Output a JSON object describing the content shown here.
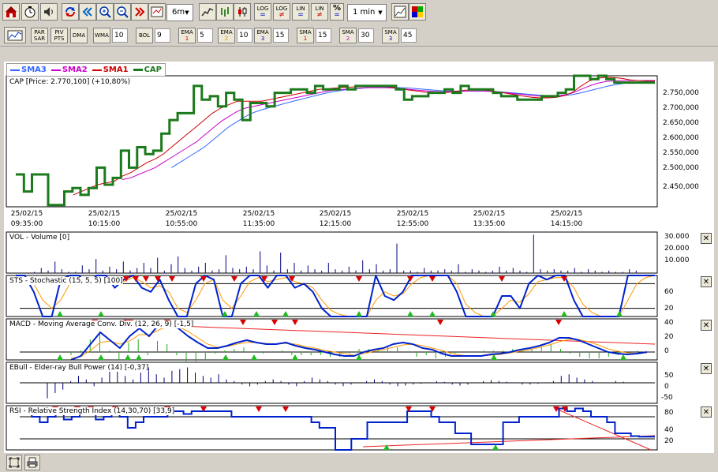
{
  "toolbar": {
    "period_value": "6m",
    "interval_value": "1 min",
    "log_label": "LOG",
    "lin_label": "LIN",
    "percent_label": "%",
    "par_sar": [
      "PAR",
      "SAR"
    ],
    "piv_pts": [
      "PIV",
      "PTS"
    ],
    "dma_label": "DMA",
    "wma_label": "WMA",
    "wma_value": "10",
    "bol_label": "BOL",
    "bol_value": "9",
    "ema1_label": "EMA",
    "ema1_num": "1",
    "ema1_value": "5",
    "ema2_label": "EMA",
    "ema2_num": "2",
    "ema2_value": "10",
    "ema3_label": "EMA",
    "ema3_num": "3",
    "ema3_value": "15",
    "sma1_label": "SMA",
    "sma1_num": "1",
    "sma1_value": "15",
    "sma2_label": "SMA",
    "sma2_num": "2",
    "sma2_value": "30",
    "sma3_label": "SMA",
    "sma3_num": "3",
    "sma3_value": "45"
  },
  "legend": {
    "sma3": "SMA3",
    "sma2": "SMA2",
    "sma1": "SMA1",
    "cap": "CAP"
  },
  "colors": {
    "cap": "#1b7a1b",
    "sma1": "#cc0000",
    "sma2": "#cc00cc",
    "sma3": "#3366ff",
    "indicator": "#0022cc",
    "signal": "#ff9900",
    "hist": "#22aa22",
    "trend": "#ee2222"
  },
  "chart_data": [
    {
      "type": "line",
      "title": "CAP [Price: 2.770,100] (+10,80%)",
      "x": [
        "25/02/15 09:35:00",
        "25/02/15 10:15:00",
        "25/02/15 10:55:00",
        "25/02/15 11:35:00",
        "25/02/15 12:15:00",
        "25/02/15 12:55:00",
        "25/02/15 13:35:00",
        "25/02/15 14:15:00"
      ],
      "x_tick_dates": [
        "25/02/15",
        "25/02/15",
        "25/02/15",
        "25/02/15",
        "25/02/15",
        "25/02/15",
        "25/02/15",
        "25/02/15"
      ],
      "x_tick_times": [
        "09:35:00",
        "10:15:00",
        "10:55:00",
        "11:35:00",
        "12:15:00",
        "12:55:00",
        "13:35:00",
        "14:15:00"
      ],
      "y_ticks": [
        "2.750,000",
        "2.700,000",
        "2.650,000",
        "2.600,000",
        "2.550,000",
        "2.500,000",
        "2.450,000"
      ],
      "ylim": [
        2405,
        2790
      ],
      "series": [
        {
          "name": "CAP",
          "values": [
            2500,
            2450,
            2500,
            2500,
            2410,
            2410,
            2450,
            2460,
            2440,
            2460,
            2520,
            2470,
            2490,
            2570,
            2520,
            2580,
            2560,
            2570,
            2620,
            2660,
            2680,
            2680,
            2760,
            2720,
            2730,
            2700,
            2740,
            2720,
            2660,
            2710,
            2710,
            2700,
            2740,
            2740,
            2750,
            2750,
            2740,
            2760,
            2750,
            2750,
            2760,
            2750,
            2760,
            2760,
            2760,
            2760,
            2760,
            2750,
            2720,
            2730,
            2730,
            2740,
            2740,
            2750,
            2740,
            2760,
            2750,
            2750,
            2750,
            2740,
            2730,
            2730,
            2720,
            2720,
            2720,
            2730,
            2730,
            2740,
            2750,
            2790,
            2790,
            2780,
            2790,
            2780,
            2770,
            2770,
            2770,
            2770,
            2770
          ]
        },
        {
          "name": "SMA1",
          "values": [
            null,
            null,
            null,
            null,
            null,
            null,
            null,
            2440,
            2450,
            2460,
            2470,
            2475,
            2480,
            2495,
            2505,
            2520,
            2535,
            2545,
            2560,
            2580,
            2600,
            2620,
            2640,
            2660,
            2680,
            2695,
            2705,
            2715,
            2715,
            2715,
            2715,
            2720,
            2725,
            2730,
            2735,
            2740,
            2745,
            2750,
            2752,
            2754,
            2756,
            2757,
            2758,
            2758,
            2758,
            2758,
            2756,
            2752,
            2748,
            2745,
            2742,
            2740,
            2740,
            2742,
            2745,
            2748,
            2748,
            2748,
            2746,
            2742,
            2738,
            2734,
            2730,
            2727,
            2725,
            2725,
            2727,
            2732,
            2742,
            2760,
            2775,
            2782,
            2786,
            2785,
            2782,
            2778,
            2776,
            2775,
            2774
          ]
        },
        {
          "name": "SMA2",
          "values": [
            null,
            null,
            null,
            null,
            null,
            null,
            null,
            null,
            null,
            null,
            null,
            null,
            null,
            2485,
            2490,
            2500,
            2510,
            2520,
            2535,
            2550,
            2565,
            2580,
            2595,
            2615,
            2635,
            2655,
            2670,
            2685,
            2695,
            2700,
            2705,
            2710,
            2715,
            2720,
            2725,
            2730,
            2735,
            2740,
            2745,
            2748,
            2750,
            2752,
            2754,
            2755,
            2755,
            2755,
            2754,
            2752,
            2750,
            2748,
            2746,
            2744,
            2743,
            2743,
            2744,
            2745,
            2745,
            2745,
            2744,
            2742,
            2740,
            2737,
            2735,
            2732,
            2730,
            2730,
            2731,
            2734,
            2740,
            2750,
            2760,
            2768,
            2773,
            2775,
            2776,
            2776,
            2776,
            2776,
            2776
          ]
        },
        {
          "name": "SMA3",
          "values": [
            null,
            null,
            null,
            null,
            null,
            null,
            null,
            null,
            null,
            null,
            null,
            null,
            null,
            null,
            null,
            null,
            null,
            null,
            null,
            2520,
            2535,
            2550,
            2565,
            2580,
            2600,
            2620,
            2640,
            2655,
            2670,
            2682,
            2690,
            2697,
            2703,
            2710,
            2716,
            2722,
            2728,
            2734,
            2740,
            2744,
            2748,
            2751,
            2753,
            2755,
            2756,
            2756,
            2756,
            2755,
            2754,
            2752,
            2750,
            2748,
            2746,
            2745,
            2745,
            2745,
            2745,
            2745,
            2744,
            2743,
            2741,
            2739,
            2737,
            2735,
            2733,
            2731,
            2731,
            2732,
            2735,
            2740,
            2746,
            2752,
            2758,
            2763,
            2767,
            2770,
            2772,
            2773,
            2773
          ]
        }
      ]
    },
    {
      "type": "bar",
      "title": "VOL - Volume [0]",
      "y_ticks": [
        "30.000",
        "20.000",
        "10.000"
      ],
      "ylim": [
        0,
        32000
      ],
      "values": [
        0,
        1000,
        4000,
        2000,
        9000,
        3000,
        1000,
        1000,
        6000,
        3000,
        11000,
        2000,
        5000,
        3000,
        9000,
        2000,
        4000,
        8000,
        4000,
        12000,
        2000,
        7000,
        13000,
        4000,
        2000,
        5000,
        8000,
        2000,
        3000,
        14000,
        4000,
        3000,
        5000,
        3000,
        17000,
        6000,
        2000,
        16000,
        3000,
        8000,
        2000,
        6000,
        3000,
        2000,
        8000,
        3000,
        2000,
        5000,
        2000,
        10000,
        3000,
        7000,
        2000,
        3000,
        23000,
        2000,
        2000,
        1000,
        4000,
        2000,
        2000,
        3000,
        2000,
        7000,
        1000,
        3000,
        2000,
        1000,
        2000,
        5000,
        2000,
        4000,
        2000,
        1000,
        30000,
        3000,
        2000,
        3000,
        2000,
        2000,
        4000,
        1000,
        3000,
        2000,
        1000,
        2000,
        1000,
        1000,
        3000,
        2000
      ]
    },
    {
      "type": "line",
      "title": "STS - Stochastic (15, 5, 5) [100]",
      "y_ticks": [
        "60",
        "20"
      ],
      "ylim": [
        0,
        100
      ],
      "series": [
        {
          "name": "%K",
          "values": [
            100,
            100,
            60,
            0,
            0,
            90,
            100,
            100,
            80,
            100,
            100,
            70,
            90,
            100,
            70,
            60,
            90,
            40,
            0,
            0,
            80,
            100,
            90,
            0,
            0,
            80,
            100,
            100,
            70,
            100,
            100,
            70,
            80,
            60,
            20,
            0,
            0,
            0,
            0,
            0,
            100,
            50,
            40,
            60,
            100,
            100,
            100,
            100,
            100,
            60,
            0,
            0,
            0,
            0,
            50,
            50,
            20,
            80,
            100,
            90,
            100,
            100,
            40,
            0,
            0,
            0,
            0,
            0,
            100,
            100,
            100,
            100
          ]
        },
        {
          "name": "%D",
          "values": [
            90,
            95,
            80,
            40,
            20,
            40,
            80,
            95,
            85,
            90,
            95,
            85,
            85,
            95,
            85,
            70,
            75,
            60,
            20,
            10,
            40,
            80,
            90,
            40,
            20,
            50,
            85,
            95,
            85,
            90,
            95,
            85,
            80,
            70,
            40,
            15,
            5,
            0,
            0,
            0,
            40,
            60,
            50,
            55,
            80,
            95,
            100,
            100,
            100,
            80,
            30,
            10,
            0,
            0,
            20,
            40,
            35,
            55,
            85,
            90,
            95,
            95,
            70,
            30,
            10,
            0,
            0,
            0,
            40,
            80,
            95,
            100
          ]
        }
      ]
    },
    {
      "type": "line",
      "title": "MACD - Moving Average Conv. Div. (12, 26, 9) [-1,5]",
      "y_ticks": [
        "40",
        "20",
        "0"
      ],
      "ylim": [
        -10,
        42
      ],
      "series": [
        {
          "name": "MACD",
          "values": [
            -10,
            -5,
            10,
            25,
            15,
            5,
            20,
            30,
            20,
            35,
            38,
            30,
            20,
            12,
            5,
            5,
            8,
            12,
            15,
            12,
            10,
            10,
            12,
            8,
            5,
            3,
            0,
            -3,
            -5,
            -5,
            0,
            3,
            5,
            10,
            12,
            10,
            5,
            3,
            -2,
            -5,
            -5,
            -5,
            -5,
            -3,
            -2,
            0,
            3,
            5,
            8,
            12,
            18,
            18,
            15,
            10,
            5,
            0,
            -2,
            -3,
            -2,
            0
          ]
        },
        {
          "name": "Signal",
          "values": [
            -8,
            -6,
            2,
            12,
            14,
            10,
            14,
            22,
            22,
            28,
            33,
            32,
            26,
            18,
            10,
            6,
            7,
            10,
            12,
            12,
            11,
            10,
            11,
            10,
            7,
            5,
            2,
            0,
            -2,
            -4,
            -2,
            1,
            3,
            6,
            9,
            10,
            8,
            5,
            2,
            -2,
            -4,
            -5,
            -5,
            -4,
            -3,
            -1,
            1,
            3,
            6,
            9,
            13,
            16,
            16,
            13,
            9,
            4,
            1,
            -1,
            -2,
            -1
          ]
        }
      ]
    },
    {
      "type": "bar",
      "title": "EBull - Elder-ray Bull Power (14) [-0,37]",
      "y_ticks": [
        "50",
        "0",
        "-50"
      ],
      "ylim": [
        -60,
        60
      ],
      "values": [
        -45,
        -30,
        -20,
        5,
        20,
        10,
        -10,
        15,
        40,
        35,
        20,
        10,
        30,
        45,
        25,
        15,
        35,
        40,
        45,
        30,
        20,
        15,
        25,
        10,
        5,
        -5,
        -10,
        -5,
        5,
        10,
        5,
        -5,
        -10,
        5,
        15,
        10,
        5,
        -5,
        -10,
        -5,
        0,
        5,
        10,
        5,
        -5,
        -10,
        -8,
        -5,
        -3,
        0,
        5,
        3,
        -5,
        -8,
        -5,
        0,
        5,
        8,
        5,
        3,
        0,
        -5,
        -5,
        -3,
        0,
        5,
        20,
        25,
        15,
        10,
        5,
        0,
        0,
        5,
        3,
        0
      ]
    },
    {
      "type": "line",
      "title": "RSI - Relative Strength Index (14,30,70) [33,9]",
      "y_ticks": [
        "80",
        "40",
        "20"
      ],
      "ylim": [
        10,
        90
      ],
      "series": [
        {
          "name": "RSI",
          "values": [
            80,
            80,
            70,
            60,
            70,
            80,
            65,
            70,
            80,
            80,
            65,
            70,
            80,
            70,
            50,
            60,
            70,
            70,
            70,
            80,
            80,
            75,
            80,
            80,
            80,
            80,
            80,
            70,
            70,
            70,
            70,
            70,
            70,
            70,
            70,
            70,
            70,
            60,
            50,
            50,
            10,
            10,
            30,
            30,
            60,
            60,
            60,
            60,
            60,
            80,
            80,
            80,
            70,
            60,
            60,
            40,
            40,
            20,
            20,
            20,
            20,
            60,
            60,
            70,
            70,
            70,
            70,
            70,
            85,
            80,
            85,
            80,
            70,
            70,
            60,
            40,
            40,
            35,
            34,
            34
          ]
        }
      ]
    }
  ]
}
